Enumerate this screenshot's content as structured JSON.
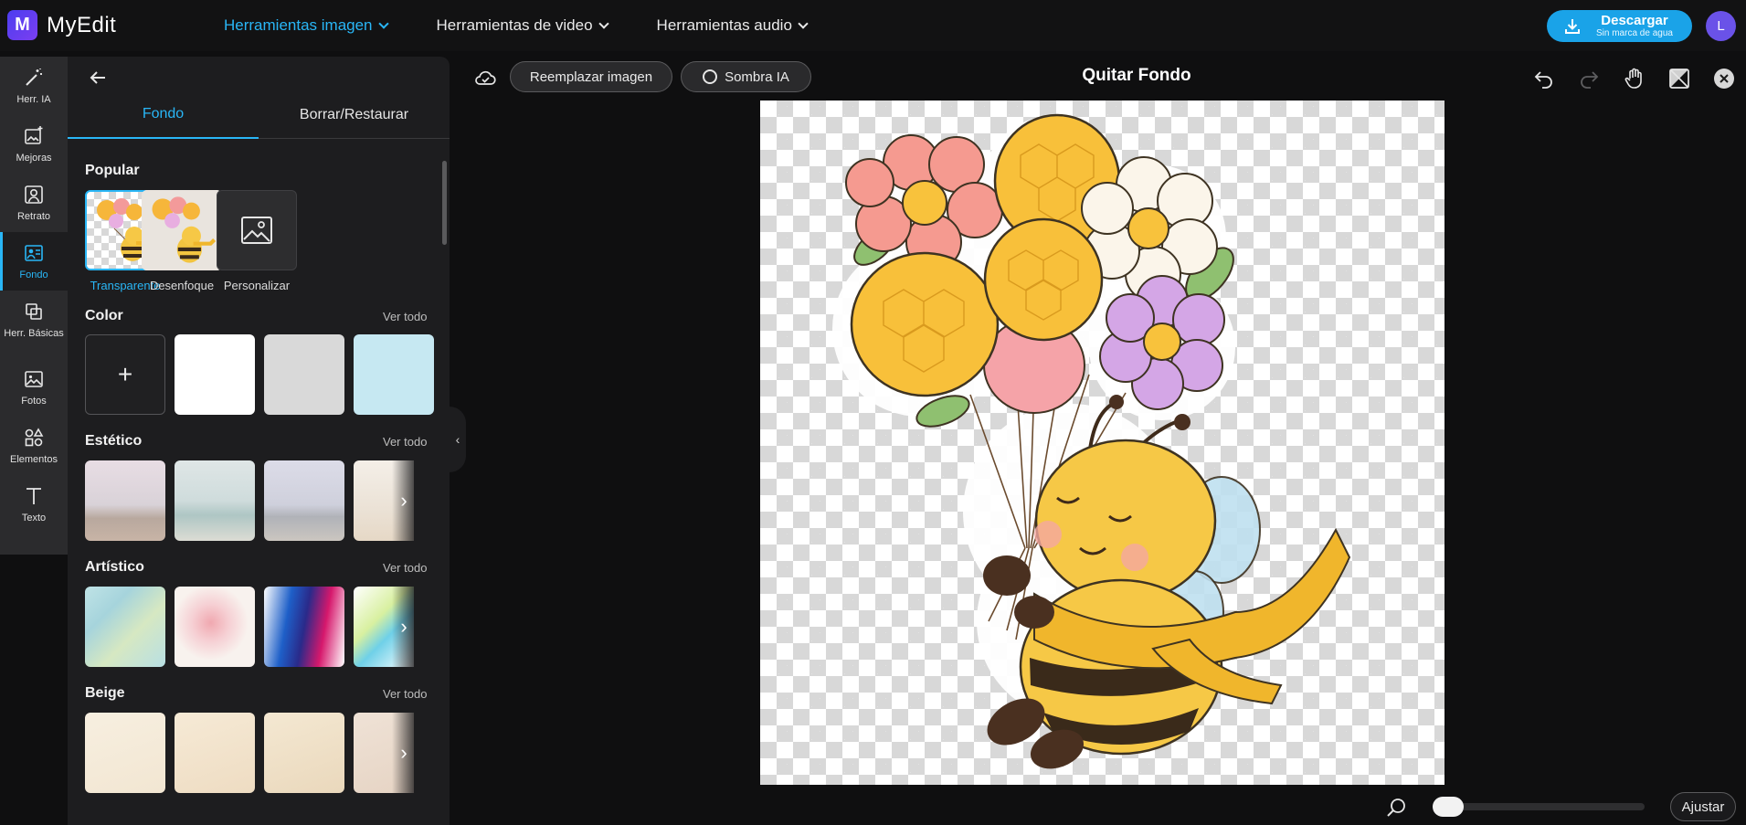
{
  "app": {
    "name": "MyEdit",
    "logo_letter": "M"
  },
  "topnav": [
    {
      "label": "Herramientas imagen",
      "active": true
    },
    {
      "label": "Herramientas de video",
      "active": false
    },
    {
      "label": "Herramientas audio",
      "active": false
    }
  ],
  "download": {
    "label": "Descargar",
    "sublabel": "Sin marca de agua"
  },
  "user": {
    "initial": "L"
  },
  "rail": [
    {
      "label": "Herr. IA",
      "icon": "magic-wand-icon"
    },
    {
      "label": "Mejoras",
      "icon": "image-enhance-icon"
    },
    {
      "label": "Retrato",
      "icon": "portrait-icon"
    },
    {
      "label": "Fondo",
      "icon": "background-icon",
      "active": true
    },
    {
      "label": "Herr. Básicas",
      "icon": "crop-icon"
    },
    {
      "label": "Fotos",
      "icon": "photo-icon"
    },
    {
      "label": "Elementos",
      "icon": "shapes-icon"
    },
    {
      "label": "Texto",
      "icon": "text-icon"
    }
  ],
  "panel": {
    "tabs": [
      {
        "label": "Fondo",
        "active": true
      },
      {
        "label": "Borrar/Restaurar",
        "active": false
      }
    ],
    "see_all": "Ver todo",
    "popular": {
      "title": "Popular",
      "items": [
        {
          "label": "Transparente",
          "active": true
        },
        {
          "label": "Desenfoque"
        },
        {
          "label": "Personalizar"
        }
      ]
    },
    "color": {
      "title": "Color",
      "add_symbol": "+",
      "swatches": [
        "#ffffff",
        "#d9d9d9",
        "#c6e8f2"
      ]
    },
    "aesthetic": {
      "title": "Estético"
    },
    "artistic": {
      "title": "Artístico"
    },
    "beige": {
      "title": "Beige"
    }
  },
  "canvas_toolbar": {
    "replace_label": "Reemplazar imagen",
    "shadow_label": "Sombra IA",
    "title": "Quitar Fondo"
  },
  "zoom": {
    "fit_label": "Ajustar",
    "level": 0.0
  },
  "colors": {
    "accent": "#29b6f6",
    "download": "#1aa3e8",
    "avatar": "#6a52e8"
  }
}
